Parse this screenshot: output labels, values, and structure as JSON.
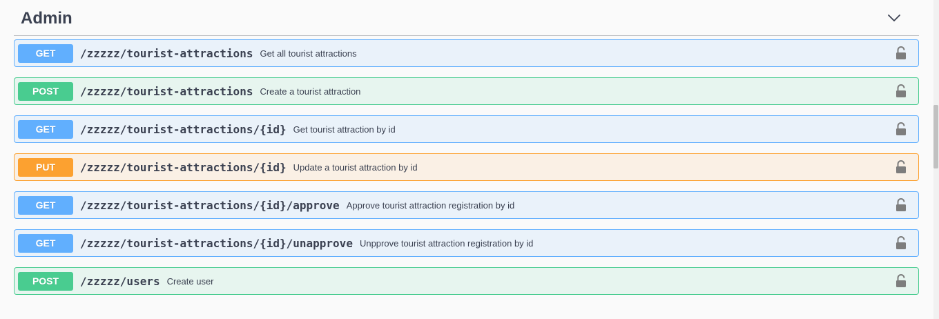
{
  "tag": {
    "title": "Admin",
    "expanded_icon": "chevron-down-icon"
  },
  "operations": [
    {
      "method": "GET",
      "path": "/zzzzz/tourist-attractions",
      "summary": "Get all tourist attractions"
    },
    {
      "method": "POST",
      "path": "/zzzzz/tourist-attractions",
      "summary": "Create a tourist attraction"
    },
    {
      "method": "GET",
      "path": "/zzzzz/tourist-attractions/{id}",
      "summary": "Get tourist attraction by id"
    },
    {
      "method": "PUT",
      "path": "/zzzzz/tourist-attractions/{id}",
      "summary": "Update a tourist attraction by id"
    },
    {
      "method": "GET",
      "path": "/zzzzz/tourist-attractions/{id}/approve",
      "summary": "Approve tourist attraction registration by id"
    },
    {
      "method": "GET",
      "path": "/zzzzz/tourist-attractions/{id}/unapprove",
      "summary": "Unpprove tourist attraction registration by id"
    },
    {
      "method": "POST",
      "path": "/zzzzz/users",
      "summary": "Create user"
    }
  ],
  "icons": {
    "lock": "unlocked-lock-icon"
  },
  "colors": {
    "get": "#61affe",
    "post": "#49cc90",
    "put": "#fca130",
    "text": "#3b4151",
    "lock": "#7d7d7d"
  }
}
